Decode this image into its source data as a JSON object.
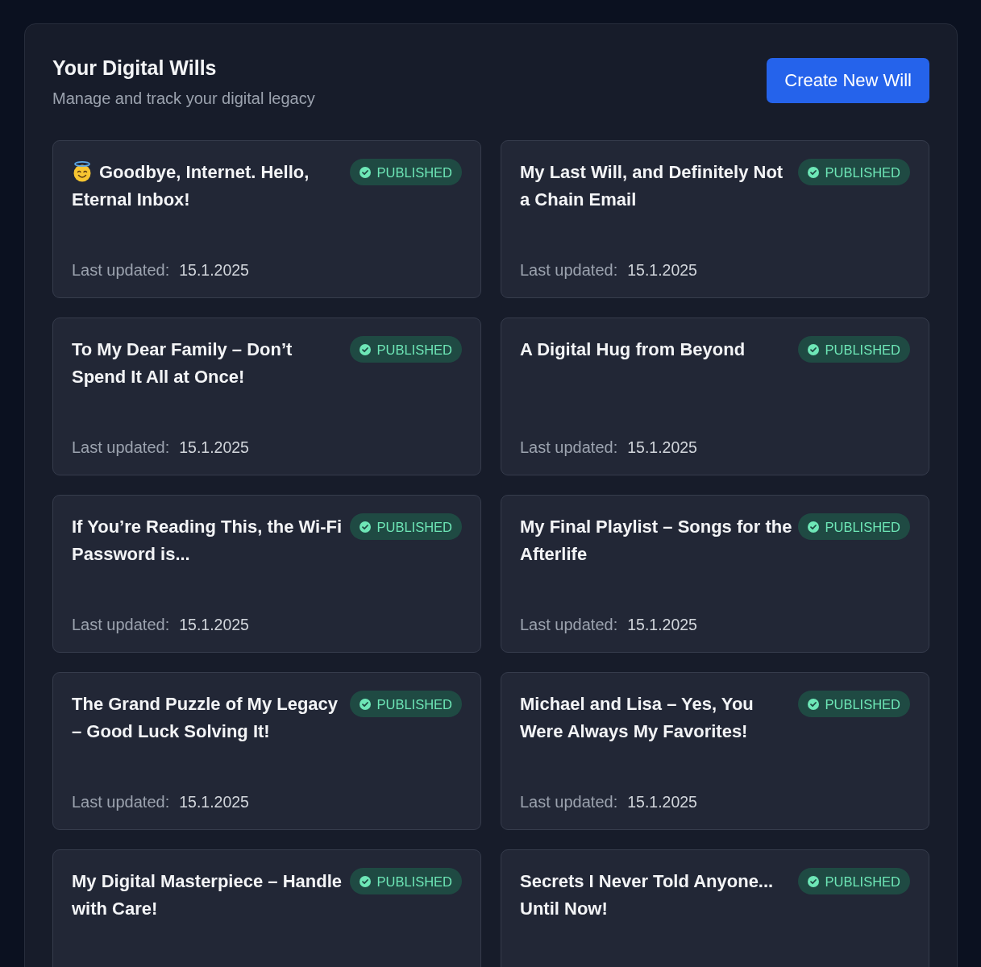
{
  "header": {
    "title": "Your Digital Wills",
    "subtitle": "Manage and track your digital legacy",
    "create_button": "Create New Will"
  },
  "wills": [
    {
      "leading_emoji": true,
      "title": "Goodbye, Internet. Hello, Eternal Inbox!",
      "status": {
        "kind": "published",
        "label": "PUBLISHED"
      },
      "updated_label": "Last updated:",
      "updated_date": "15.1.2025"
    },
    {
      "leading_emoji": false,
      "title": "My Last Will, and Definitely Not a Chain Email",
      "status": {
        "kind": "published",
        "label": "PUBLISHED"
      },
      "updated_label": "Last updated:",
      "updated_date": "15.1.2025"
    },
    {
      "leading_emoji": false,
      "title": "To My Dear Family – Don’t Spend It All at Once!",
      "status": {
        "kind": "published",
        "label": "PUBLISHED"
      },
      "updated_label": "Last updated:",
      "updated_date": "15.1.2025"
    },
    {
      "leading_emoji": false,
      "title": "A Digital Hug from Beyond",
      "status": {
        "kind": "published",
        "label": "PUBLISHED"
      },
      "updated_label": "Last updated:",
      "updated_date": "15.1.2025"
    },
    {
      "leading_emoji": false,
      "title": "If You’re Reading This, the Wi-Fi Password is...",
      "status": {
        "kind": "published",
        "label": "PUBLISHED"
      },
      "updated_label": "Last updated:",
      "updated_date": "15.1.2025"
    },
    {
      "leading_emoji": false,
      "title": "My Final Playlist – Songs for the Afterlife",
      "status": {
        "kind": "published",
        "label": "PUBLISHED"
      },
      "updated_label": "Last updated:",
      "updated_date": "15.1.2025"
    },
    {
      "leading_emoji": false,
      "title": "The Grand Puzzle of My Legacy – Good Luck Solving It!",
      "status": {
        "kind": "published",
        "label": "PUBLISHED"
      },
      "updated_label": "Last updated:",
      "updated_date": "15.1.2025"
    },
    {
      "leading_emoji": false,
      "title": "Michael and Lisa – Yes, You Were Always My Favorites!",
      "status": {
        "kind": "published",
        "label": "PUBLISHED"
      },
      "updated_label": "Last updated:",
      "updated_date": "15.1.2025"
    },
    {
      "leading_emoji": false,
      "title": "My Digital Masterpiece – Handle with Care!",
      "status": {
        "kind": "published",
        "label": "PUBLISHED"
      }
    },
    {
      "leading_emoji": false,
      "title": "Secrets I Never Told Anyone... Until Now!",
      "status": {
        "kind": "published",
        "label": "PUBLISHED"
      }
    }
  ]
}
